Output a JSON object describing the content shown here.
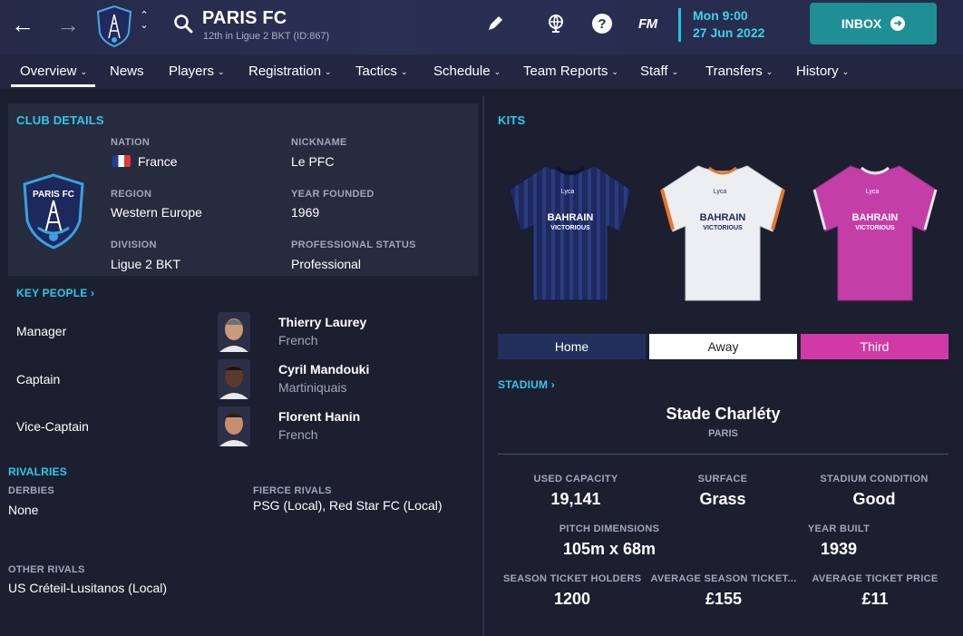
{
  "header": {
    "club_name": "PARIS FC",
    "club_subtitle": "12th in Ligue 2 BKT (ID:867)",
    "fm_logo": "FM",
    "date_day": "Mon 9:00",
    "date_full": "27 Jun 2022",
    "inbox_label": "INBOX",
    "icons": [
      "back-arrow-icon",
      "forward-arrow-icon",
      "club-crest-icon",
      "switch-chevron-icon",
      "search-icon",
      "pencil-icon",
      "globe-icon",
      "help-icon"
    ]
  },
  "tabs": [
    {
      "label": "Overview",
      "dropdown": true,
      "active": true
    },
    {
      "label": "News",
      "dropdown": false
    },
    {
      "label": "Players",
      "dropdown": true
    },
    {
      "label": "Registration",
      "dropdown": true
    },
    {
      "label": "Tactics",
      "dropdown": true
    },
    {
      "label": "Schedule",
      "dropdown": true
    },
    {
      "label": "Team Reports",
      "dropdown": true
    },
    {
      "label": "Staff",
      "dropdown": true
    },
    {
      "label": "Transfers",
      "dropdown": true
    },
    {
      "label": "History",
      "dropdown": true
    }
  ],
  "club_details": {
    "title": "CLUB DETAILS",
    "crest_text": "PARIS FC",
    "nation_label": "NATION",
    "nation": "France",
    "nickname_label": "NICKNAME",
    "nickname": "Le PFC",
    "region_label": "REGION",
    "region": "Western Europe",
    "year_founded_label": "YEAR FOUNDED",
    "year_founded": "1969",
    "division_label": "DIVISION",
    "division": "Ligue 2 BKT",
    "professional_status_label": "PROFESSIONAL STATUS",
    "professional_status": "Professional"
  },
  "key_people": {
    "title": "KEY PEOPLE",
    "people": [
      {
        "role": "Manager",
        "name": "Thierry Laurey",
        "nationality": "French"
      },
      {
        "role": "Captain",
        "name": "Cyril Mandouki",
        "nationality": "Martiniquais"
      },
      {
        "role": "Vice-Captain",
        "name": "Florent Hanin",
        "nationality": "French"
      }
    ]
  },
  "rivalries": {
    "title": "RIVALRIES",
    "derbies_label": "DERBIES",
    "derbies": "None",
    "fierce_label": "FIERCE RIVALS",
    "fierce": "PSG (Local), Red Star FC (Local)",
    "other_label": "OTHER RIVALS",
    "other": "US Créteil-Lusitanos (Local)"
  },
  "kits": {
    "title": "KITS",
    "sponsor_line1": "BAHRAIN",
    "sponsor_line2": "VICTORIOUS",
    "shirt_sponsor_top": "Lyca",
    "tabs": [
      {
        "label": "Home",
        "color": "#22305e"
      },
      {
        "label": "Away",
        "color": "#ffffff"
      },
      {
        "label": "Third",
        "color": "#d13aa6"
      }
    ]
  },
  "stadium": {
    "title": "STADIUM",
    "name": "Stade Charléty",
    "city": "PARIS",
    "used_capacity_label": "USED CAPACITY",
    "used_capacity": "19,141",
    "surface_label": "SURFACE",
    "surface": "Grass",
    "condition_label": "STADIUM CONDITION",
    "condition": "Good",
    "pitch_label": "PITCH DIMENSIONS",
    "pitch": "105m x 68m",
    "year_built_label": "YEAR BUILT",
    "year_built": "1939",
    "season_ticket_holders_label": "SEASON TICKET HOLDERS",
    "season_ticket_holders": "1200",
    "avg_season_ticket_label": "AVERAGE SEASON TICKET...",
    "avg_season_ticket": "£155",
    "avg_ticket_label": "AVERAGE TICKET PRICE",
    "avg_ticket": "£11"
  },
  "colors": {
    "accent": "#31c7ea",
    "inbox": "#1f8f95",
    "background": "#1c1f30",
    "panel": "#272b3e"
  }
}
